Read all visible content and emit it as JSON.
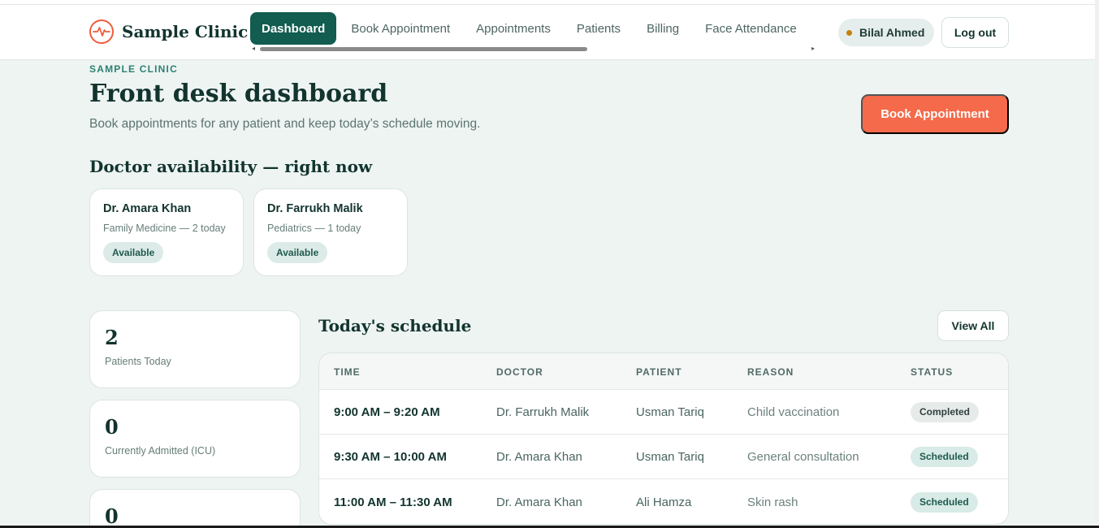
{
  "brand": {
    "name": "Sample Clinic",
    "accent": "#ef5c3d"
  },
  "nav": {
    "items": [
      {
        "label": "Dashboard",
        "active": true
      },
      {
        "label": "Book Appointment"
      },
      {
        "label": "Appointments"
      },
      {
        "label": "Patients"
      },
      {
        "label": "Billing"
      },
      {
        "label": "Face Attendance"
      }
    ]
  },
  "user": {
    "name": "Bilal Ahmed",
    "logout_label": "Log out"
  },
  "page": {
    "eyebrow": "SAMPLE CLINIC",
    "title": "Front desk dashboard",
    "subtitle": "Book appointments for any patient and keep today’s schedule moving.",
    "book_label": "Book Appointment"
  },
  "availability": {
    "title": "Doctor availability — right now",
    "doctors": [
      {
        "name": "Dr. Amara Khan",
        "meta": "Family Medicine — 2 today",
        "status": "Available"
      },
      {
        "name": "Dr. Farrukh Malik",
        "meta": "Pediatrics — 1 today",
        "status": "Available"
      }
    ]
  },
  "stats": [
    {
      "value": "2",
      "label": "Patients Today"
    },
    {
      "value": "0",
      "label": "Currently Admitted (ICU)"
    },
    {
      "value": "0",
      "label": ""
    }
  ],
  "schedule": {
    "title": "Today's schedule",
    "view_all_label": "View All",
    "columns": [
      "TIME",
      "DOCTOR",
      "PATIENT",
      "REASON",
      "STATUS"
    ],
    "rows": [
      {
        "time": "9:00 AM – 9:20 AM",
        "doctor": "Dr. Farrukh Malik",
        "patient": "Usman Tariq",
        "reason": "Child vaccination",
        "status": "Completed"
      },
      {
        "time": "9:30 AM – 10:00 AM",
        "doctor": "Dr. Amara Khan",
        "patient": "Usman Tariq",
        "reason": "General consultation",
        "status": "Scheduled"
      },
      {
        "time": "11:00 AM – 11:30 AM",
        "doctor": "Dr. Amara Khan",
        "patient": "Ali Hamza",
        "reason": "Skin rash",
        "status": "Scheduled"
      }
    ]
  },
  "colors": {
    "primary": "#125c50",
    "cta": "#f46a4a",
    "background": "#eef4f2"
  }
}
